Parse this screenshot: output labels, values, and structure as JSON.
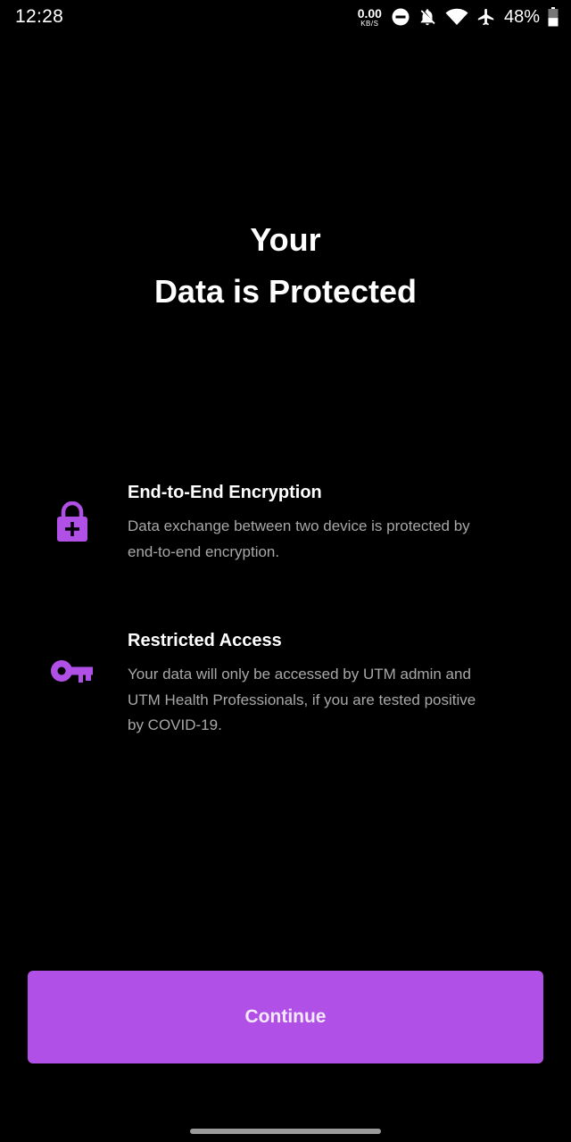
{
  "status_bar": {
    "time": "12:28",
    "net_speed_value": "0.00",
    "net_speed_unit": "KB/S",
    "battery_percent": "48%",
    "battery_level": 0.48,
    "icons": [
      "do-not-disturb-icon",
      "notifications-off-icon",
      "wifi-icon",
      "airplane-icon",
      "battery-icon"
    ]
  },
  "header": {
    "title_line1": "Your",
    "title_line2": "Data is Protected"
  },
  "features": [
    {
      "icon": "lock-plus-icon",
      "title": "End-to-End Encryption",
      "description": "Data exchange between two device is protected by end-to-end encryption."
    },
    {
      "icon": "key-icon",
      "title": "Restricted Access",
      "description": "Your data will only be accessed by UTM admin and UTM Health Professionals, if you are tested positive by COVID-19."
    }
  ],
  "actions": {
    "continue_label": "Continue"
  },
  "colors": {
    "background": "#000000",
    "accent": "#b150e6",
    "icon": "#b150e6",
    "text_primary": "#ffffff",
    "text_secondary": "#a8a8a8"
  }
}
